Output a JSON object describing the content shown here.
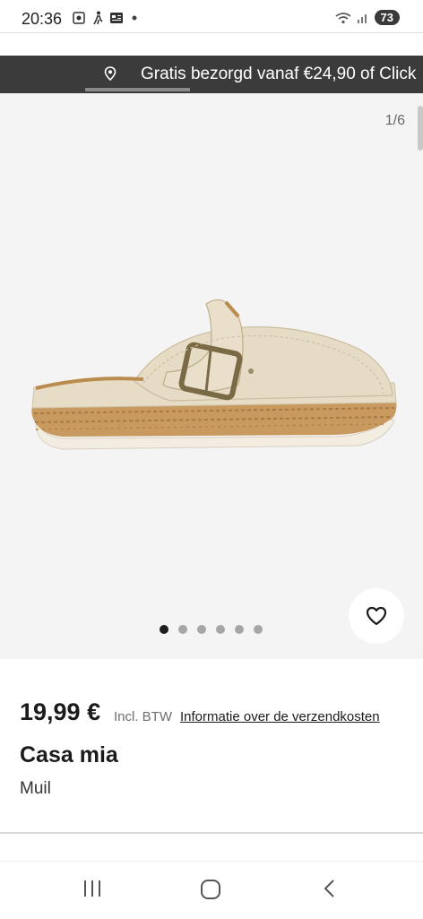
{
  "status_bar": {
    "time": "20:36",
    "battery": "73",
    "icons": [
      "screenshot-icon",
      "walking-icon",
      "news-icon",
      "dot-icon",
      "wifi-icon",
      "signal-icon",
      "battery-icon"
    ]
  },
  "banner": {
    "text": "Gratis bezorgd vanaf €24,90 of Click"
  },
  "gallery": {
    "counter": "1/6",
    "total_dots": 6,
    "active_dot": 1
  },
  "product": {
    "price": "19,99 €",
    "vat_label": "Incl. BTW",
    "shipping_link": "Informatie over de verzendkosten",
    "brand": "Casa mia",
    "type": "Muil"
  },
  "colors": {
    "banner_bg": "#3b3b3b",
    "gallery_bg": "#f4f4f4",
    "text": "#1b1b1b",
    "shoe": "#e8dcc5"
  }
}
